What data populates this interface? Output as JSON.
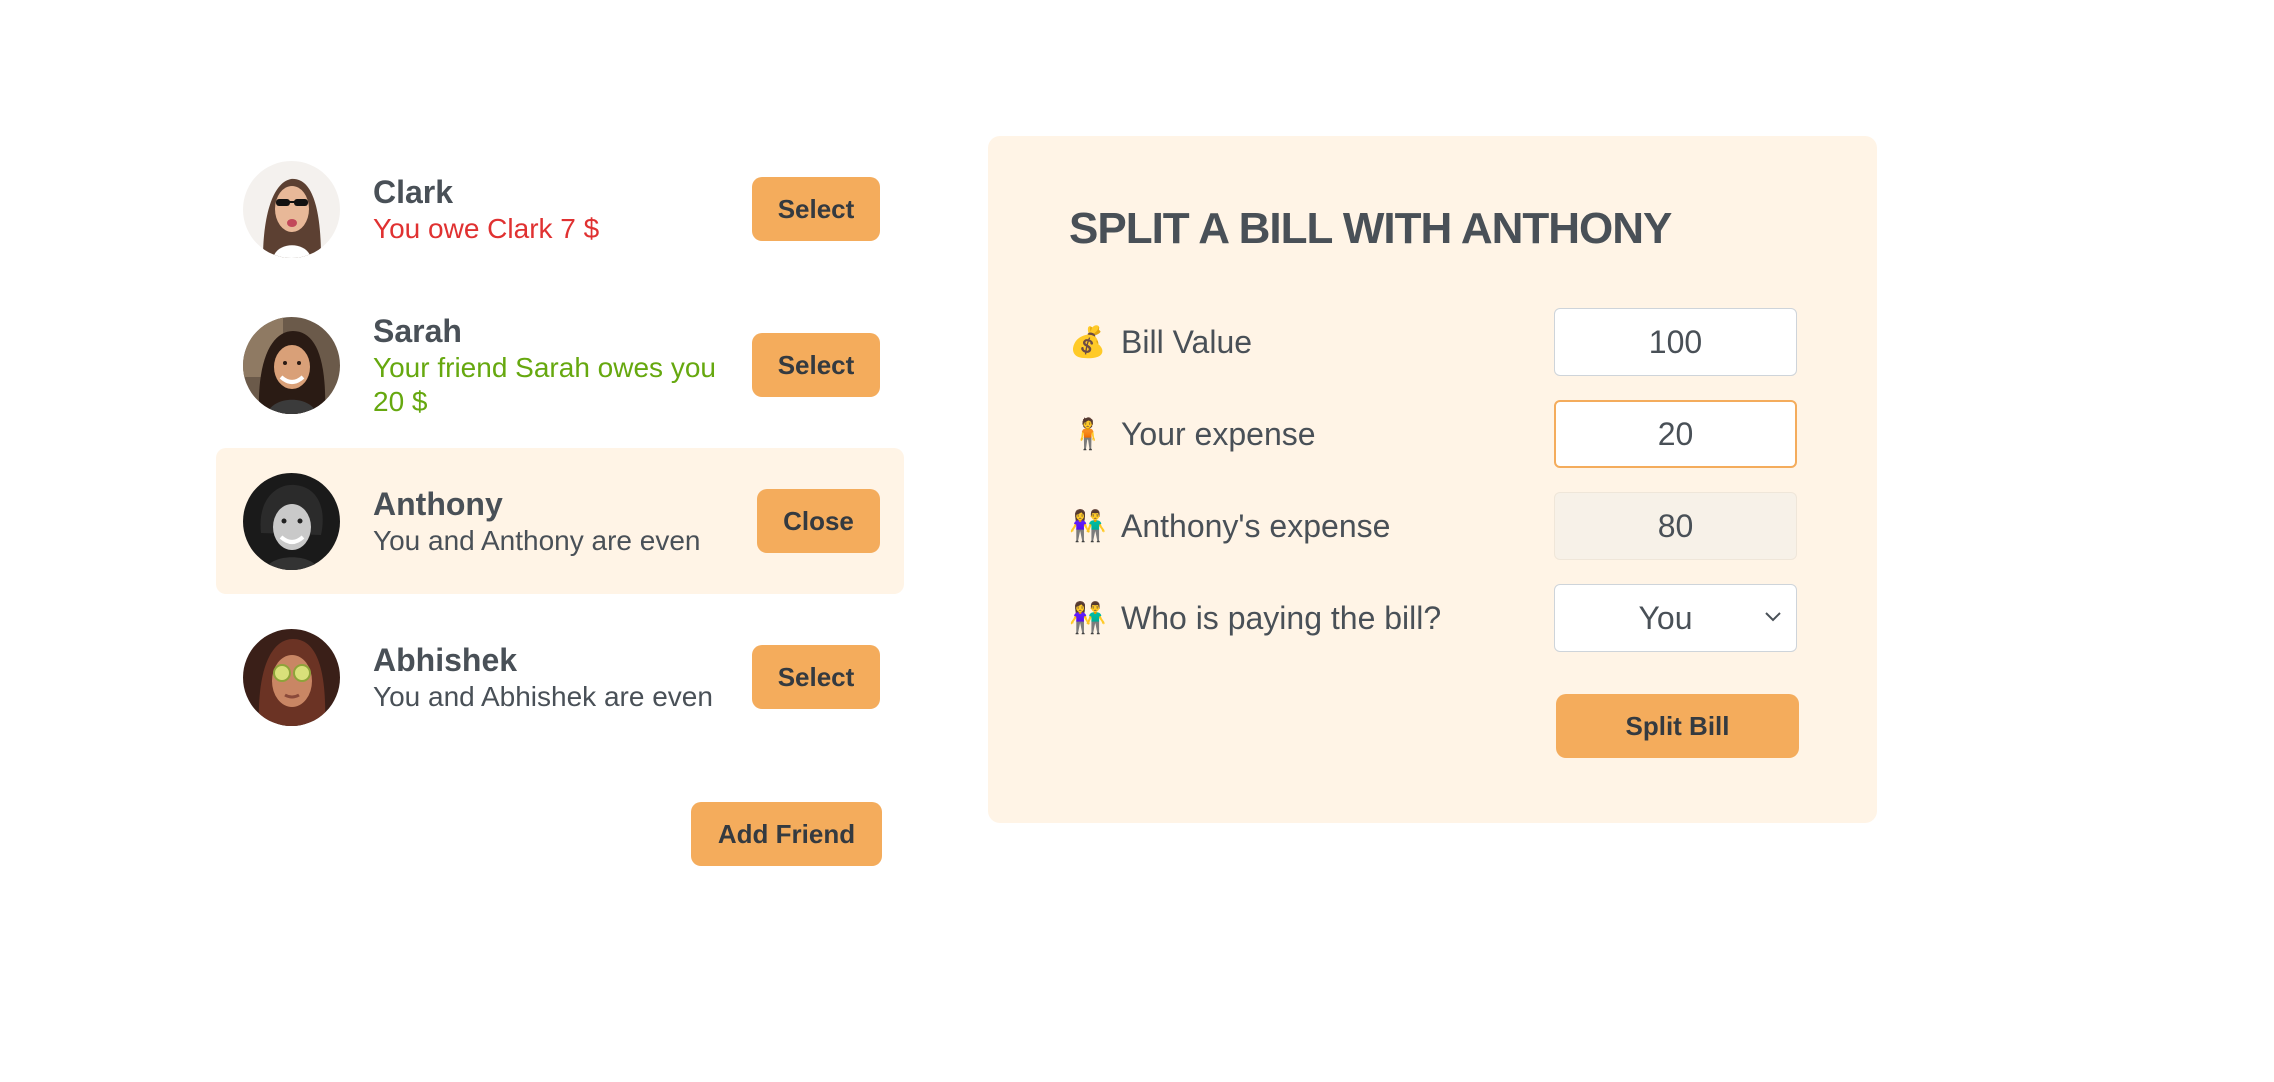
{
  "friends": [
    {
      "name": "Clark",
      "status": "You owe Clark 7 $",
      "status_tone": "red",
      "button": "Select",
      "avatar": "avatar-clark"
    },
    {
      "name": "Sarah",
      "status": "Your friend Sarah owes you 20 $",
      "status_tone": "green",
      "button": "Select",
      "avatar": "avatar-sarah"
    },
    {
      "name": "Anthony",
      "status": "You and Anthony are even",
      "status_tone": "neutral",
      "button": "Close",
      "avatar": "avatar-anthony",
      "selected": true
    },
    {
      "name": "Abhishek",
      "status": "You and Abhishek are even",
      "status_tone": "neutral",
      "button": "Select",
      "avatar": "avatar-abhishek"
    }
  ],
  "add_friend_label": "Add Friend",
  "split_form": {
    "title": "SPLIT A BILL WITH ANTHONY",
    "bill_value": {
      "emoji": "💰",
      "label": "Bill Value",
      "value": "100"
    },
    "your_expense": {
      "emoji": "🧍",
      "label": "Your expense",
      "value": "20"
    },
    "friend_expense": {
      "emoji": "👫",
      "label": "Anthony's expense",
      "value": "80"
    },
    "who_pays": {
      "emoji": "👫",
      "label": "Who is paying the bill?",
      "selected": "You"
    },
    "submit_label": "Split Bill"
  },
  "colors": {
    "accent": "#f4ac5c",
    "selected_bg": "#fff4e6",
    "owe_red": "#e03131",
    "owed_green": "#66a80f",
    "text": "#495057"
  }
}
